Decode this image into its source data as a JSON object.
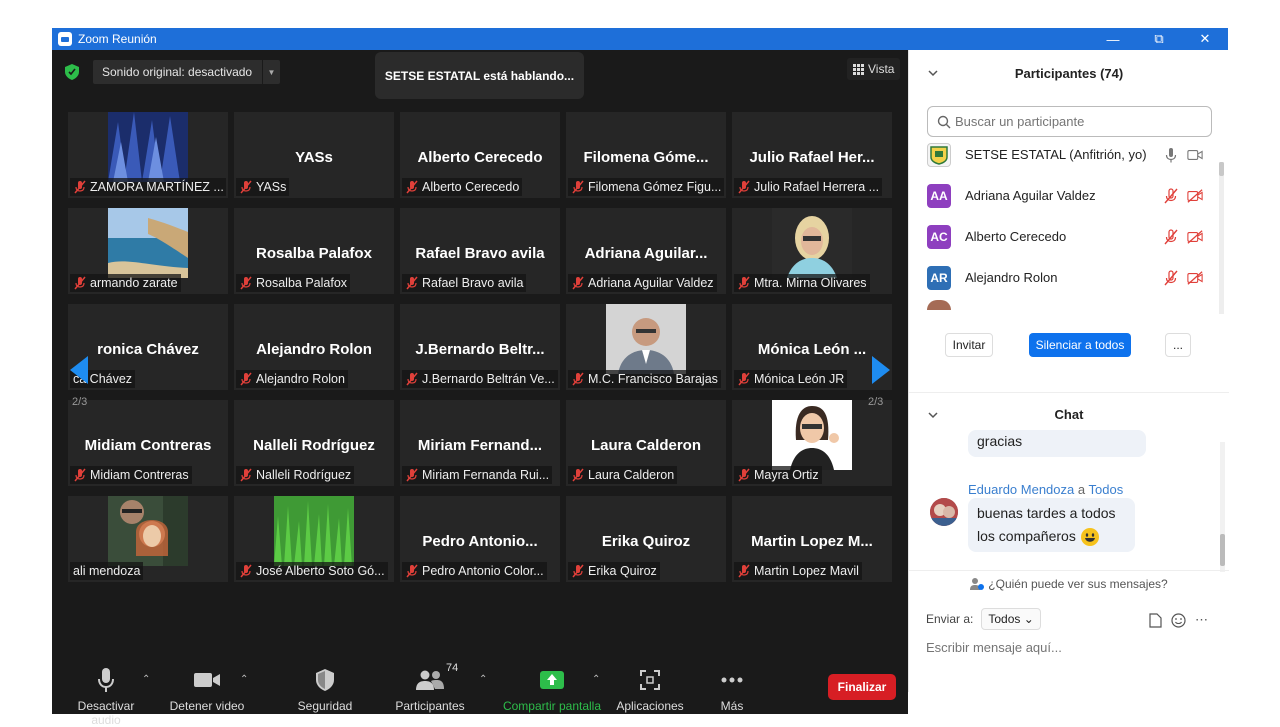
{
  "window": {
    "title": "Zoom Reunión"
  },
  "meeting": {
    "sound_label": "Sonido original: desactivado",
    "speaking_label": "SETSE ESTATAL está hablando...",
    "view_label": "Vista",
    "page_left": "2/3",
    "page_right": "2/3"
  },
  "tiles": [
    {
      "big": "",
      "name": "ZAMORA MARTÍNEZ ...",
      "photo": "forest"
    },
    {
      "big": "YASs",
      "name": "YASs"
    },
    {
      "big": "Alberto Cerecedo",
      "name": "Alberto Cerecedo"
    },
    {
      "big": "Filomena Góme...",
      "name": "Filomena Gómez Figu..."
    },
    {
      "big": "Julio Rafael Her...",
      "name": "Julio Rafael Herrera ..."
    },
    {
      "big": "",
      "name": "armando zarate",
      "photo": "beach"
    },
    {
      "big": "Rosalba Palafox",
      "name": "Rosalba Palafox"
    },
    {
      "big": "Rafael Bravo avila",
      "name": "Rafael Bravo avila"
    },
    {
      "big": "Adriana Aguilar...",
      "name": "Adriana Aguilar Valdez"
    },
    {
      "big": "",
      "name": "Mtra. Mirna Olivares",
      "photo": "woman"
    },
    {
      "big": "ronica Chávez",
      "name": "ca Chávez"
    },
    {
      "big": "Alejandro Rolon",
      "name": "Alejandro Rolon"
    },
    {
      "big": "J.Bernardo Beltr...",
      "name": "J.Bernardo Beltrán Ve..."
    },
    {
      "big": "",
      "name": "M.C. Francisco Barajas",
      "photo": "man"
    },
    {
      "big": "Mónica León ...",
      "name": "Mónica León JR"
    },
    {
      "big": "Midiam Contreras",
      "name": "Midiam Contreras"
    },
    {
      "big": "Nalleli Rodríguez",
      "name": "Nalleli Rodríguez"
    },
    {
      "big": "Miriam Fernand...",
      "name": "Miriam Fernanda Rui..."
    },
    {
      "big": "Laura Calderon",
      "name": "Laura Calderon"
    },
    {
      "big": "",
      "name": "Mayra Ortiz",
      "photo": "avatar"
    },
    {
      "big": "",
      "name": "ali mendoza",
      "photo": "family"
    },
    {
      "big": "",
      "name": "José Alberto Soto Gó...",
      "photo": "grass"
    },
    {
      "big": "Pedro Antonio...",
      "name": "Pedro Antonio Color..."
    },
    {
      "big": "Erika Quiroz",
      "name": "Erika Quiroz"
    },
    {
      "big": "Martin Lopez M...",
      "name": "Martin Lopez Mavil"
    }
  ],
  "toolbar": {
    "mute": "Desactivar audio",
    "video": "Detener video",
    "security": "Seguridad",
    "participants": "Participantes",
    "participants_count": "74",
    "share": "Compartir pantalla",
    "apps": "Aplicaciones",
    "more": "Más",
    "end": "Finalizar"
  },
  "participants_panel": {
    "title": "Participantes (74)",
    "search_placeholder": "Buscar un participante",
    "list": [
      {
        "initials": "",
        "name": "SETSE ESTATAL (Anfitrión, yo)",
        "color": "#f4f4f4"
      },
      {
        "initials": "AA",
        "name": "Adriana Aguilar Valdez",
        "color": "#8e3fbf"
      },
      {
        "initials": "AC",
        "name": "Alberto Cerecedo",
        "color": "#8e3fbf"
      },
      {
        "initials": "AR",
        "name": "Alejandro Rolon",
        "color": "#2e6fb5"
      }
    ],
    "invite": "Invitar",
    "mute_all": "Silenciar a todos",
    "more": "..."
  },
  "chat": {
    "title": "Chat",
    "prev_message": "gracias",
    "sender": "Eduardo Mendoza",
    "to_word": "a",
    "recipient": "Todos",
    "message_line1": "buenas tardes a todos",
    "message_line2": "los compañeros",
    "who_can": "¿Quién puede ver sus mensajes?",
    "send_to_label": "Enviar a:",
    "send_to_value": "Todos",
    "input_placeholder": "Escribir mensaje aquí..."
  },
  "colors": {
    "titlebar": "#1e6fd9",
    "accent": "#0e72ed",
    "end": "#d71e24",
    "share": "#2dbd4a",
    "muted_red": "#e0403a"
  }
}
